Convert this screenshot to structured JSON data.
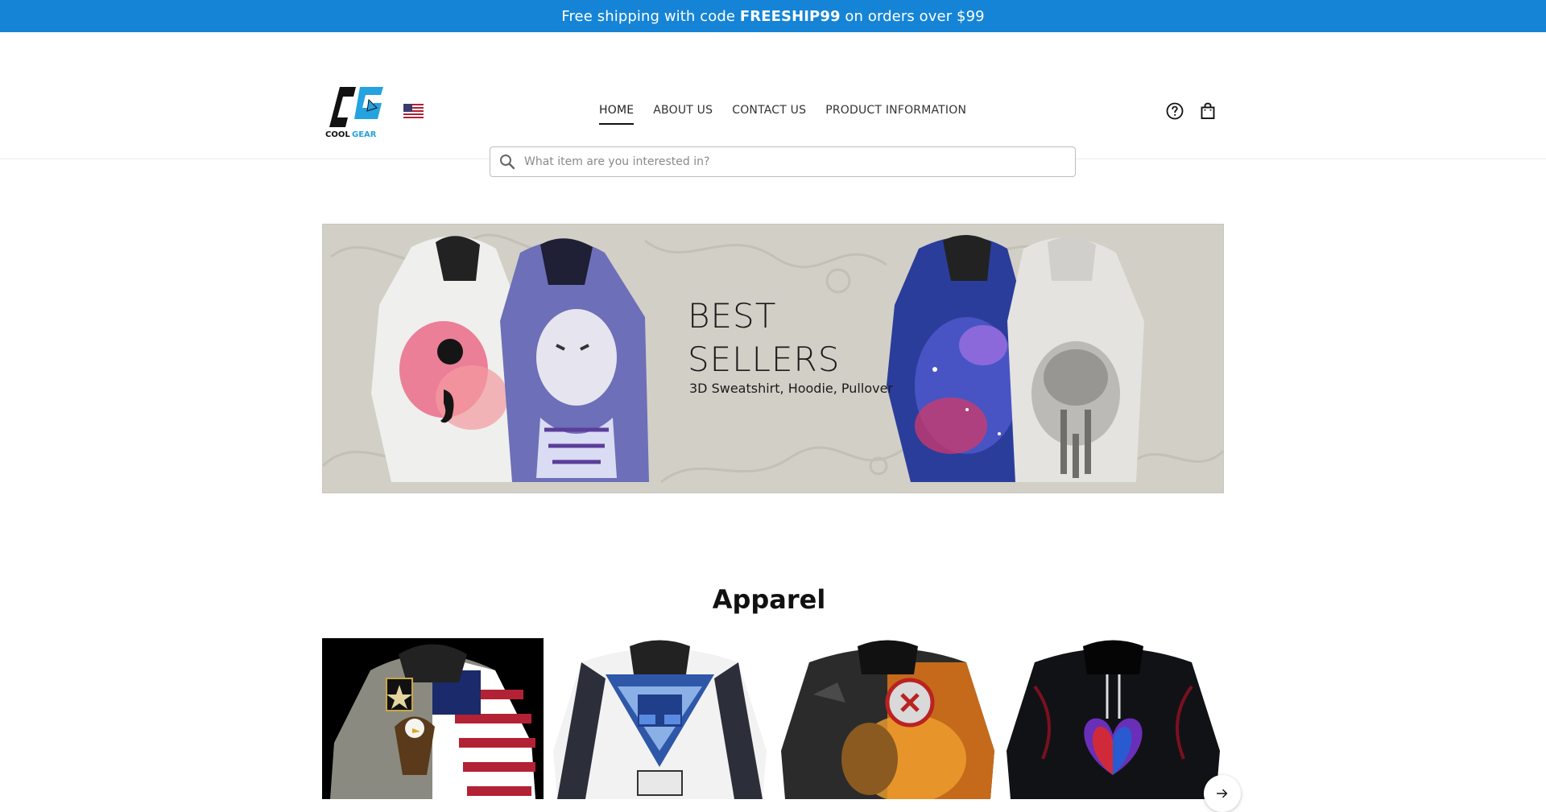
{
  "announcement": {
    "prefix": "Free shipping with code ",
    "code": "FREESHIP99",
    "suffix": " on orders over $99"
  },
  "header": {
    "logo_text": "COOL GEAR",
    "nav": [
      {
        "label": "HOME",
        "active": true
      },
      {
        "label": "ABOUT US",
        "active": false
      },
      {
        "label": "CONTACT US",
        "active": false
      },
      {
        "label": "PRODUCT INFORMATION",
        "active": false
      }
    ],
    "icons": [
      "help-icon",
      "shopping-bag-icon",
      "us-flag-icon"
    ]
  },
  "search": {
    "placeholder": "What item are you interested in?",
    "value": ""
  },
  "hero": {
    "title_line1": "BEST",
    "title_line2": "SELLERS",
    "subtitle": "3D Sweatshirt, Hoodie, Pullover"
  },
  "section": {
    "title": "Apparel"
  },
  "products": [
    {
      "image": "army-eagle-flag-hoodie"
    },
    {
      "image": "trucker-blue-hoodie"
    },
    {
      "image": "firefighter-hoodie"
    },
    {
      "image": "dragon-heart-hoodie"
    }
  ],
  "colors": {
    "announcement_bg": "#1584d6",
    "hero_bg": "#d2cfc7",
    "text": "#111111"
  }
}
